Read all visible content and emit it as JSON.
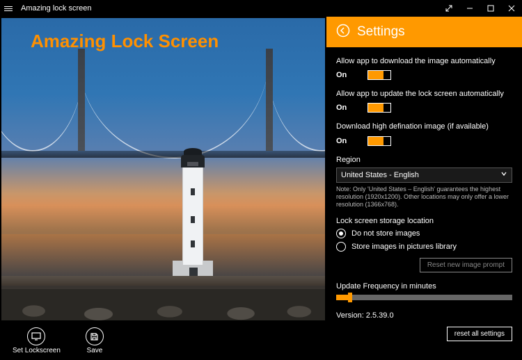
{
  "titlebar": {
    "app_title": "Amazing lock screen"
  },
  "left": {
    "overlay_title": "Amazing Lock Screen",
    "actions": {
      "set_lockscreen": "Set Lockscreen",
      "save": "Save"
    }
  },
  "settings": {
    "title": "Settings",
    "allow_download": {
      "label": "Allow app to download the image automatically",
      "state": "On"
    },
    "allow_update": {
      "label": "Allow app to update the lock screen automatically",
      "state": "On"
    },
    "high_def": {
      "label": "Download high defination image (if available)",
      "state": "On"
    },
    "region": {
      "label": "Region",
      "selected": "United States - English",
      "note": "Note: Only 'United States – English' guarantees the highest resolution (1920x1200). Other locations may only offer a lower resolution (1366x768)."
    },
    "storage": {
      "label": "Lock screen storage location",
      "opt1": "Do not store images",
      "opt2": "Store images in pictures library"
    },
    "reset_prompt": "Reset new image prompt",
    "frequency": {
      "label": "Update Frequency in minutes"
    },
    "version": "Version: 2.5.39.0",
    "reset_all": "reset all settings"
  }
}
